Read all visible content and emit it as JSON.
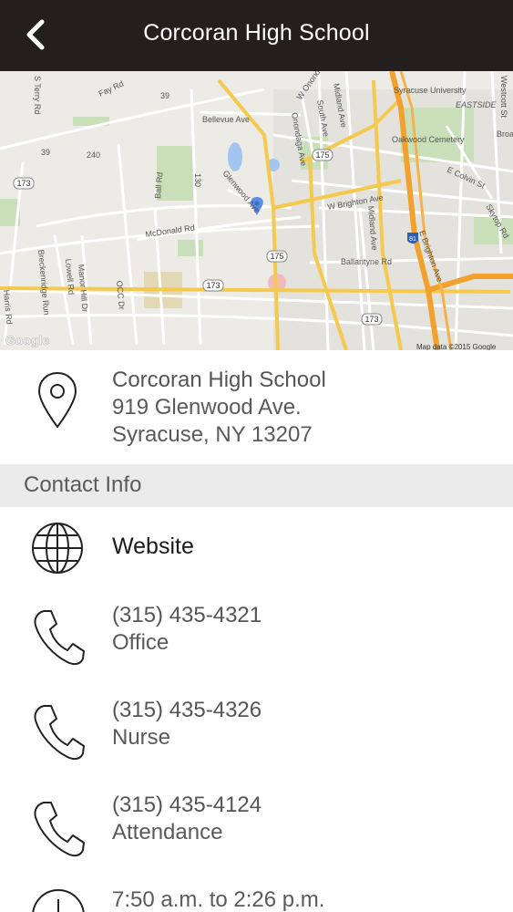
{
  "header": {
    "title": "Corcoran High School"
  },
  "map": {
    "labels": {
      "fay_rd": "Fay Rd",
      "terry_rd": "S Terry Rd",
      "rt39a": "39",
      "rt39b": "39",
      "bellevue": "Bellevue Ave",
      "rt240": "240",
      "rt173a": "173",
      "rt173b": "173",
      "rt173c": "173",
      "rt175a": "175",
      "rt175b": "175",
      "rt130": "130",
      "glenwood": "Glenwood Ave",
      "ball_rd": "Ball Rd",
      "mcdonald": "McDonald Rd",
      "w_onondaga": "W Onondaga",
      "onondaga_ave": "Onondaga Ave",
      "south_ave": "South Ave",
      "midland_a": "Midland Ave",
      "midland_b": "Midland Ave",
      "w_brighton": "W Brighton Ave",
      "ballantyne": "Ballantyne Rd",
      "syracuse_u": "Syracuse University",
      "eastside": "EASTSIDE",
      "oakwood": "Oakwood Cemetery",
      "e_colvin": "E Colvin St",
      "westcott": "Westcott St",
      "broad": "Broa",
      "skytop": "Skytop Rd",
      "i81": "81",
      "e_brighton": "E Brighton Ave",
      "breckenridge": "Breckenridge Run",
      "lowell": "Lowell Rd",
      "manor_hill": "Manor Hill Dr",
      "ocd": "OCC Dr",
      "harris": "Harris Rd",
      "google": "Google",
      "attribution": "Map data ©2015 Google"
    }
  },
  "address": {
    "name": "Corcoran High School",
    "street": "919 Glenwood Ave.",
    "city": "Syracuse, NY 13207"
  },
  "contact": {
    "section_title": "Contact Info",
    "website_label": "Website",
    "phones": [
      {
        "number": "(315) 435-4321",
        "label": "Office"
      },
      {
        "number": "(315) 435-4326",
        "label": "Nurse"
      },
      {
        "number": "(315) 435-4124",
        "label": "Attendance"
      }
    ],
    "hours": "7:50 a.m. to 2:26 p.m."
  }
}
